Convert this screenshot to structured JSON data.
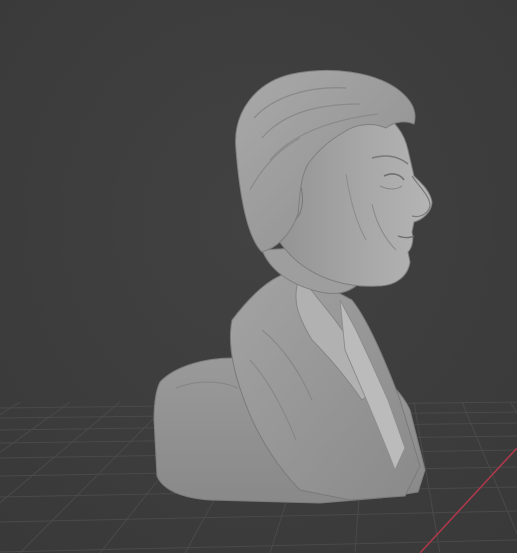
{
  "viewport": {
    "background": "#3d3d3d",
    "grid_color": "#4a4a4a",
    "x_axis_color": "#b0384a",
    "mesh_color": "#9d9d9d",
    "icons": {
      "mesh": "sculpted-head-bust-mesh-icon"
    }
  }
}
